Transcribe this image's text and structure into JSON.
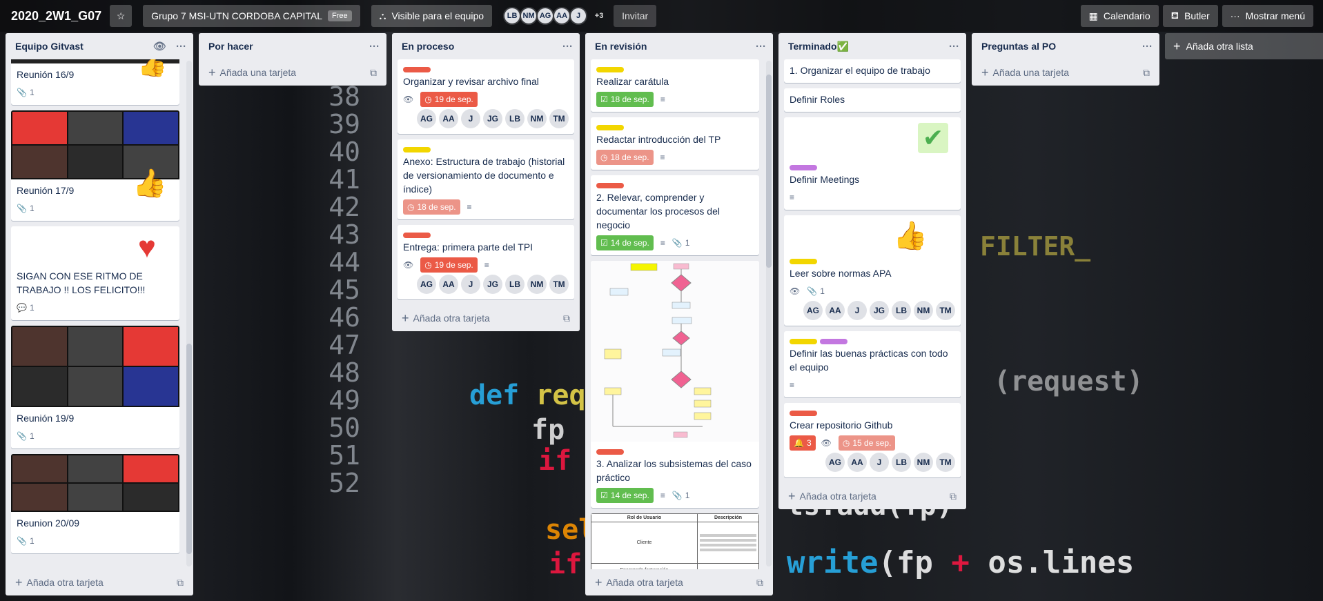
{
  "board": {
    "title": "2020_2W1_G07",
    "team": "Grupo 7 MSI-UTN CORDOBA CAPITAL",
    "plan": "Free",
    "visibility": "Visible para el equipo",
    "members": [
      "LB",
      "NM",
      "AG",
      "AA",
      "J"
    ],
    "more_members": "+3",
    "invite": "Invitar",
    "calendar": "Calendario",
    "butler": "Butler",
    "show_menu": "Mostrar menú",
    "add_list": "Añada otra lista"
  },
  "colors": {
    "red": "#eb5a46",
    "yellow": "#f2d600",
    "purple": "#c377e0",
    "green": "#61bd4f"
  },
  "lists": [
    {
      "title": "Equipo Gitvast",
      "add": "Añada otra tarjeta",
      "cards": [
        {
          "title": "Reunión 16/9",
          "attachments": "1"
        },
        {
          "title": "Reunión 17/9",
          "attachments": "1"
        },
        {
          "title": "SIGAN CON ESE RITMO DE TRABAJO !! LOS FELICITO!!!",
          "comments": "1"
        },
        {
          "title": "Reunión 19/9",
          "attachments": "1"
        },
        {
          "title": "Reunion 20/09",
          "attachments": "1"
        }
      ]
    },
    {
      "title": "Por hacer",
      "add": "Añada una tarjeta"
    },
    {
      "title": "En proceso",
      "add": "Añada otra tarjeta",
      "cards": [
        {
          "title": "Organizar y revisar archivo final",
          "due": "19 de sep.",
          "members": [
            "AG",
            "AA",
            "J",
            "JG",
            "LB",
            "NM",
            "TM"
          ]
        },
        {
          "title": "Anexo: Estructura de trabajo (historial de versionamiento de documento e índice)",
          "due": "18 de sep."
        },
        {
          "title": "Entrega: primera parte del TPI",
          "due": "19 de sep.",
          "members": [
            "AG",
            "AA",
            "J",
            "JG",
            "LB",
            "NM",
            "TM"
          ]
        }
      ]
    },
    {
      "title": "En revisión",
      "add": "Añada otra tarjeta",
      "cards": [
        {
          "title": "Realizar carátula",
          "due": "18 de sep."
        },
        {
          "title": "Redactar introducción del TP",
          "due": "18 de sep."
        },
        {
          "title": "2. Relevar, comprender y documentar los procesos del negocio",
          "due": "14 de sep.",
          "attachments": "1"
        },
        {
          "title": "3. Analizar los subsistemas del caso práctico",
          "due": "14 de sep.",
          "attachments": "1"
        }
      ],
      "table": {
        "h1": "Rol de Usuario",
        "h2": "Descripción",
        "r1": "Cliente",
        "r2": "Encargado facturación"
      }
    },
    {
      "title": "Terminado✅",
      "add": "Añada otra tarjeta",
      "cards": [
        {
          "title": "1. Organizar el equipo de trabajo"
        },
        {
          "title": "Definir Roles"
        },
        {
          "title": "Definir Meetings"
        },
        {
          "title": "Leer sobre normas APA",
          "attachments": "1",
          "members": [
            "AG",
            "AA",
            "J",
            "JG",
            "LB",
            "NM",
            "TM"
          ]
        },
        {
          "title": "Definir las buenas prácticas con todo el equipo"
        },
        {
          "title": "Crear repositorio Github",
          "notifications": "3",
          "due": "15 de sep.",
          "members": [
            "AG",
            "AA",
            "J",
            "LB",
            "NM",
            "TM"
          ]
        }
      ]
    },
    {
      "title": "Preguntas al PO",
      "add": "Añada una tarjeta"
    }
  ]
}
